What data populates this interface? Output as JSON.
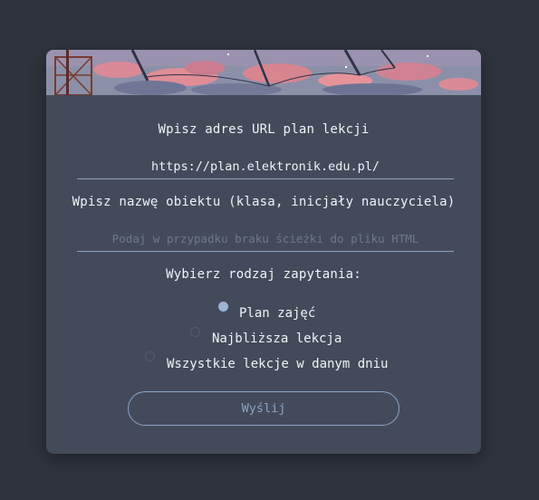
{
  "form": {
    "url_label": "Wpisz adres URL plan lekcji",
    "url_value": "https://plan.elektronik.edu.pl/",
    "object_label": "Wpisz nazwę obiektu (klasa, inicjały nauczyciela)",
    "object_placeholder": "Podaj w przypadku braku ścieżki do pliku HTML",
    "query_label": "Wybierz rodzaj zapytania:",
    "options": [
      {
        "label": "Plan zajęć",
        "checked": true
      },
      {
        "label": "Najbliższa lekcja",
        "checked": false
      },
      {
        "label": "Wszystkie lekcje w danym dniu",
        "checked": false
      }
    ],
    "submit_label": "Wyślij"
  },
  "colors": {
    "page_background": "#2e333d",
    "card_background": "#434b5a",
    "accent": "#8aa3c2",
    "radio_checked": "#9fb3d3"
  }
}
